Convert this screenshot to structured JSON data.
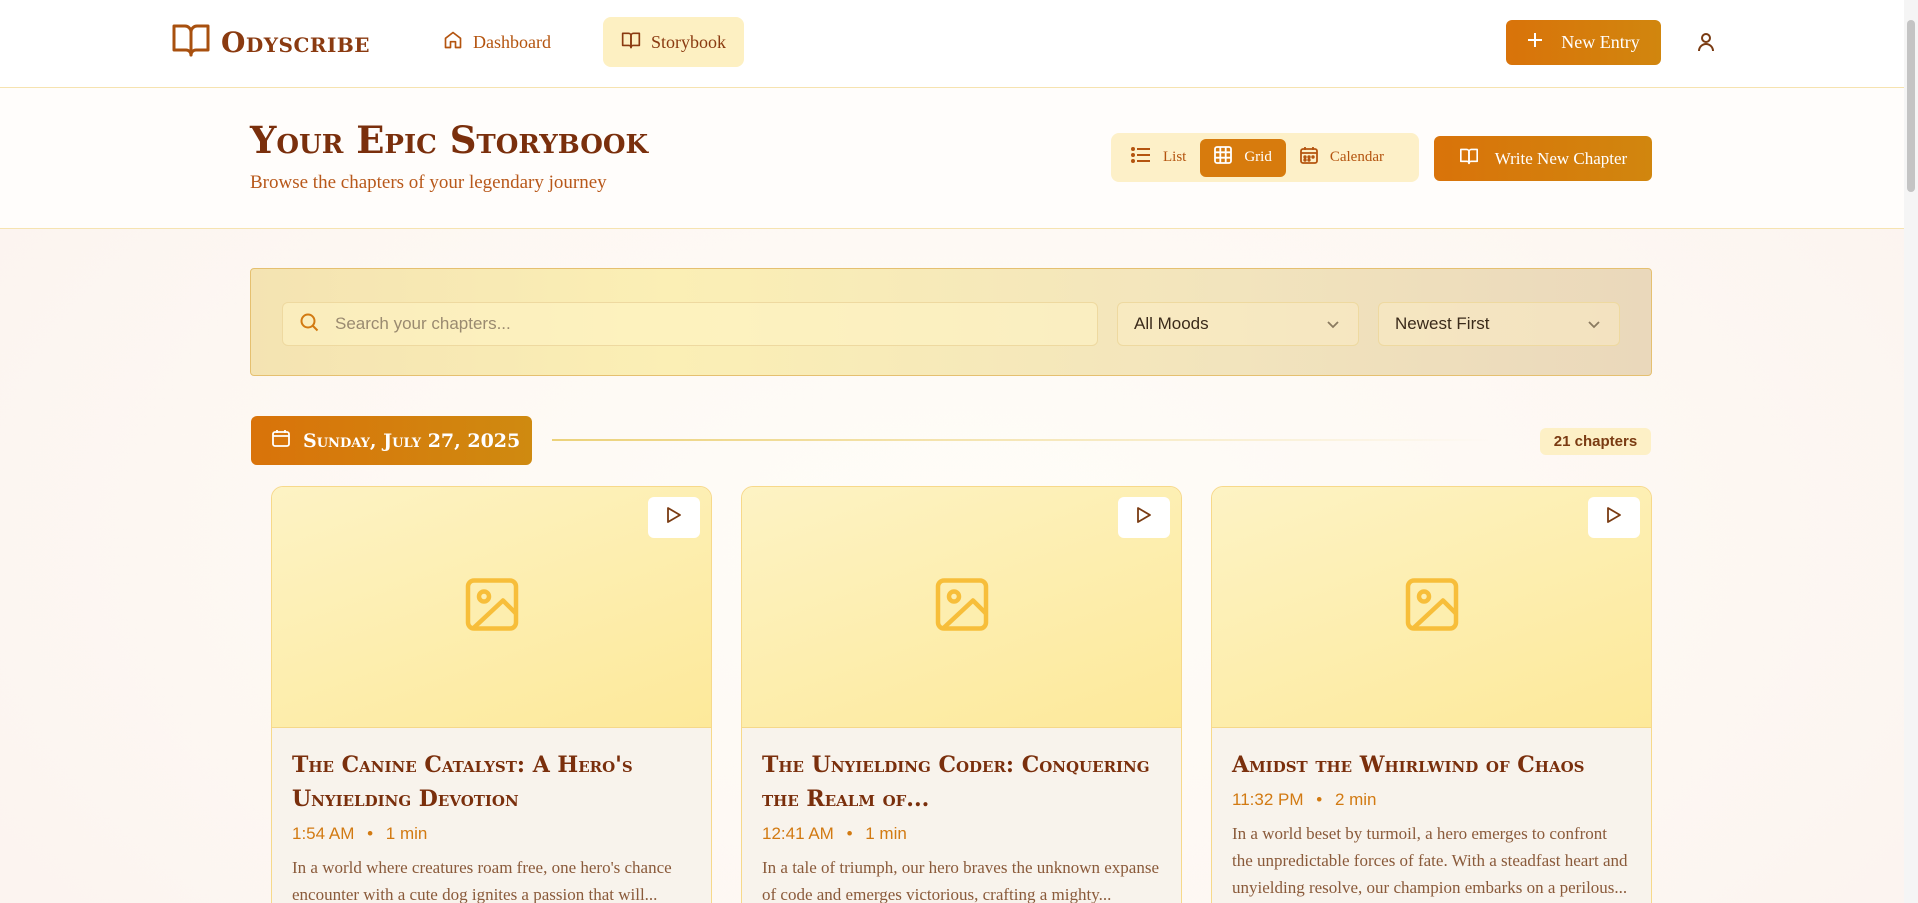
{
  "nav": {
    "logo": "Odyscribe",
    "dashboard": "Dashboard",
    "storybook": "Storybook",
    "new_entry": "New Entry"
  },
  "header": {
    "title": "Your Epic Storybook",
    "subtitle": "Browse the chapters of your legendary journey",
    "view_list": "List",
    "view_grid": "Grid",
    "view_calendar": "Calendar",
    "active_view": "Grid",
    "write_button": "Write New Chapter"
  },
  "filters": {
    "search_placeholder": "Search your chapters...",
    "mood": "All Moods",
    "sort": "Newest First"
  },
  "group": {
    "date": "Sunday, July 27, 2025",
    "count": "21 chapters"
  },
  "cards": [
    {
      "title": "The Canine Catalyst: A Hero's Unyielding Devotion",
      "time": "1:54 AM",
      "duration": "1 min",
      "excerpt": "In a world where creatures roam free, one hero's chance encounter with a cute dog ignites a passion that will..."
    },
    {
      "title": "The Unyielding Coder: Conquering the Realm of...",
      "time": "12:41 AM",
      "duration": "1 min",
      "excerpt": "In a tale of triumph, our hero braves the unknown expanse of code and emerges victorious, crafting a mighty..."
    },
    {
      "title": "Amidst the Whirlwind of Chaos",
      "time": "11:32 PM",
      "duration": "2 min",
      "excerpt": "In a world beset by turmoil, a hero emerges to confront the unpredictable forces of fate. With a steadfast heart and unyielding resolve, our champion embarks on a perilous..."
    }
  ],
  "meta_separator": "•",
  "colors": {
    "accent": "#d9730a",
    "title": "#7a2f0c",
    "highlight": "#fdf0c2"
  }
}
